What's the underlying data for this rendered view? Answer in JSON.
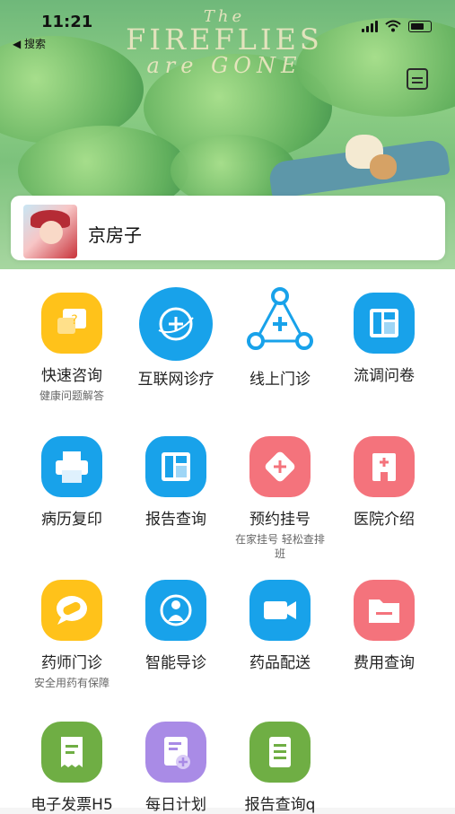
{
  "status_bar": {
    "time": "11:21",
    "back_label": "◀ 搜索"
  },
  "banner": {
    "line1": "The",
    "line2": "FIREFLIES",
    "line3": "are GONE"
  },
  "profile": {
    "name": "京房子"
  },
  "services": [
    {
      "label": "快速咨询",
      "sub": "健康问题解答",
      "icon": "chat-question-icon",
      "color": "#ffc21a"
    },
    {
      "label": "互联网诊疗",
      "sub": "",
      "icon": "globe-plus-icon",
      "color": "#18a2ea"
    },
    {
      "label": "线上门诊",
      "sub": "",
      "icon": "network-plus-icon",
      "color": "#18a2ea"
    },
    {
      "label": "流调问卷",
      "sub": "",
      "icon": "layout-icon",
      "color": "#18a2ea"
    },
    {
      "label": "病历复印",
      "sub": "",
      "icon": "printer-icon",
      "color": "#18a2ea"
    },
    {
      "label": "报告查询",
      "sub": "",
      "icon": "report-layout-icon",
      "color": "#18a2ea"
    },
    {
      "label": "预约挂号",
      "sub": "在家挂号 轻松查排班",
      "icon": "diamond-plus-icon",
      "color": "#f4737c"
    },
    {
      "label": "医院介绍",
      "sub": "",
      "icon": "hospital-icon",
      "color": "#f4737c"
    },
    {
      "label": "药师门诊",
      "sub": "安全用药有保障",
      "icon": "pill-chat-icon",
      "color": "#ffc21a"
    },
    {
      "label": "智能导诊",
      "sub": "",
      "icon": "person-guide-icon",
      "color": "#18a2ea"
    },
    {
      "label": "药品配送",
      "sub": "",
      "icon": "video-icon",
      "color": "#18a2ea"
    },
    {
      "label": "费用查询",
      "sub": "",
      "icon": "folder-minus-icon",
      "color": "#f4737c"
    },
    {
      "label": "电子发票H5",
      "sub": "",
      "icon": "receipt-icon",
      "color": "#6fae44"
    },
    {
      "label": "每日计划",
      "sub": "",
      "icon": "doc-plus-icon",
      "color": "#a98be6"
    },
    {
      "label": "报告查询q",
      "sub": "",
      "icon": "doc-lines-icon",
      "color": "#6fae44"
    }
  ]
}
